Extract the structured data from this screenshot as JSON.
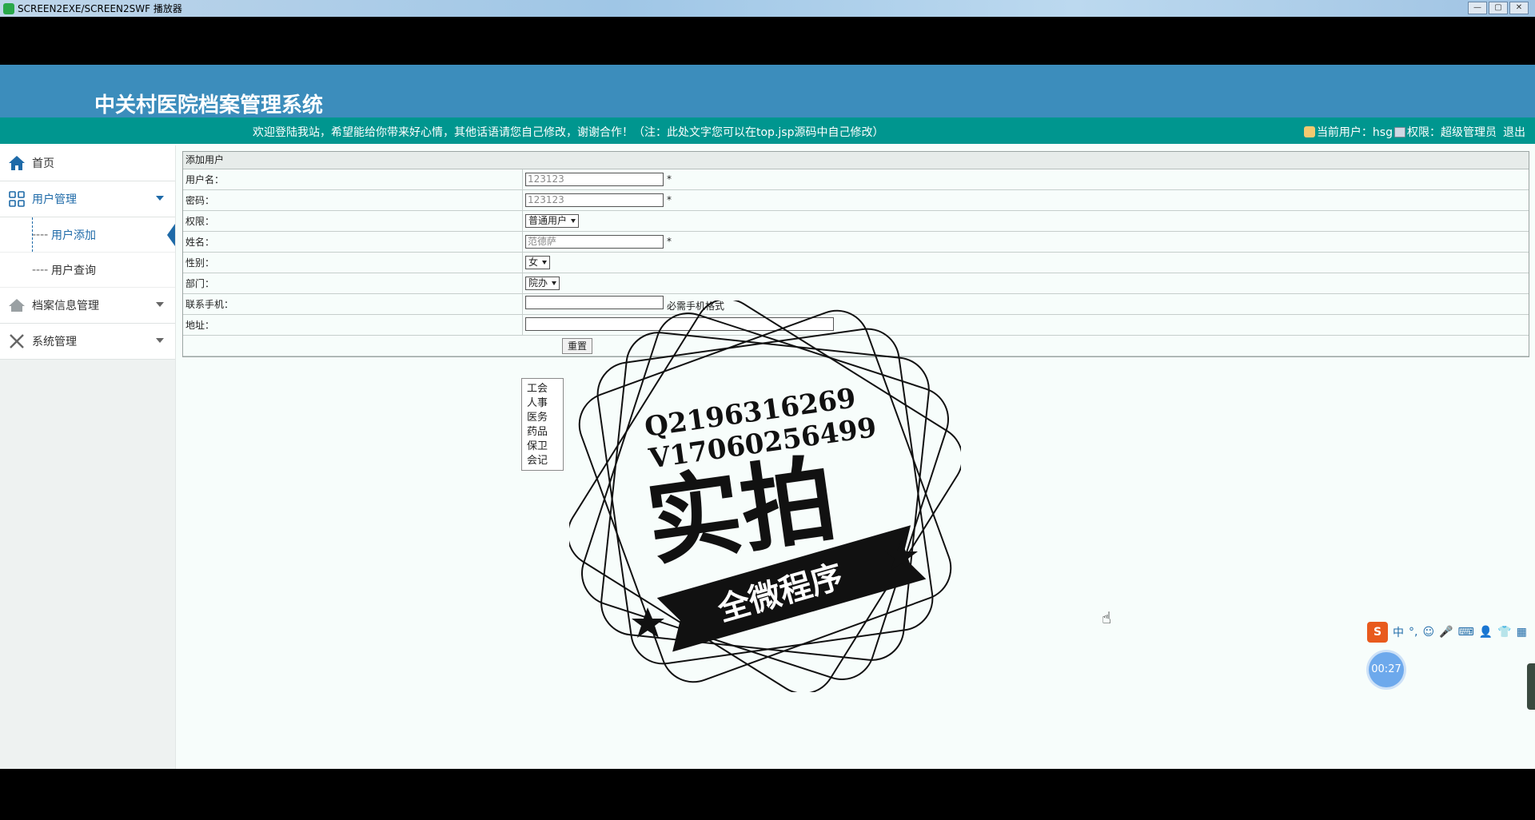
{
  "window": {
    "title": "SCREEN2EXE/SCREEN2SWF 播放器",
    "controls": [
      "—",
      "▢",
      "✕"
    ]
  },
  "header": {
    "title": "中关村医院档案管理系统"
  },
  "notice": {
    "message": "欢迎登陆我站，希望能给你带来好心情，其他话语请您自己修改，谢谢合作！（注：此处文字您可以在top.jsp源码中自己修改）",
    "current_user_label": "当前用户：hsg",
    "permission_label": "权限：超级管理员",
    "logout": "退出"
  },
  "sidebar": {
    "home": "首页",
    "user_mgmt": "用户管理",
    "user_add": "用户添加",
    "user_query": "用户查询",
    "archive_mgmt": "档案信息管理",
    "system_mgmt": "系统管理"
  },
  "form": {
    "panel_title": "添加用户",
    "rows": {
      "username": {
        "label": "用户名：",
        "value": "123123",
        "req": "*"
      },
      "password": {
        "label": "密码：",
        "value": "123123",
        "req": "*"
      },
      "permission": {
        "label": "权限：",
        "value": "普通用户"
      },
      "name": {
        "label": "姓名：",
        "value": "范德萨",
        "req": "*"
      },
      "gender": {
        "label": "性别：",
        "value": "女"
      },
      "department": {
        "label": "部门：",
        "value": "院办"
      },
      "phone": {
        "label": "联系手机：",
        "value": "",
        "hint": "必需手机格式"
      },
      "address": {
        "label": "地址：",
        "value": ""
      }
    },
    "reset_button": "重置"
  },
  "department_options": [
    "工会",
    "人事",
    "医务",
    "药品",
    "保卫",
    "会记"
  ],
  "watermark": {
    "line1": "Q2196316269",
    "line2": "V17060256499",
    "big": "实拍",
    "banner": "全微程序"
  },
  "ime": {
    "logo": "S",
    "mode": "中",
    "punct": "°,"
  },
  "timer": "00:27",
  "colors": {
    "header": "#3c8dbc",
    "notice_bar": "#00968f",
    "accent": "#1e6aa8"
  }
}
